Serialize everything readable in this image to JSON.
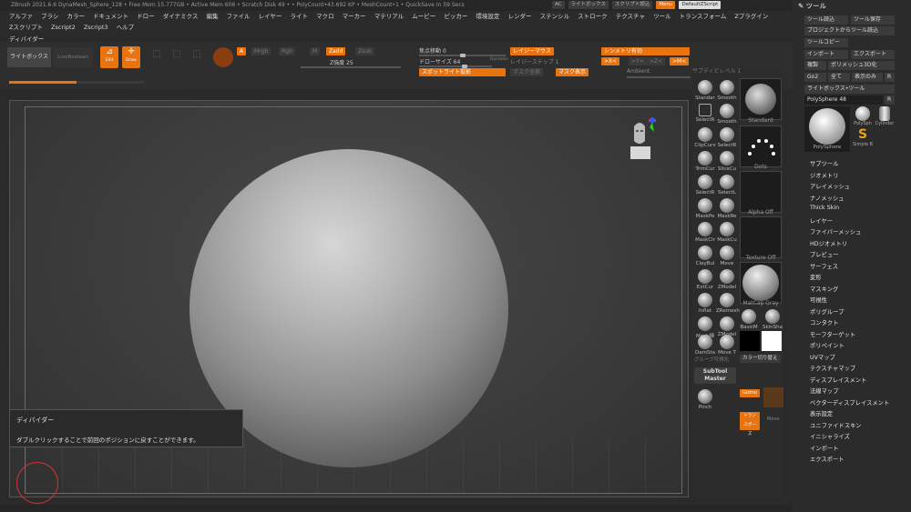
{
  "titlebar": {
    "text": "ZBrush 2021.6.6 DynaMesh_Sphere_128   • Free Mem 15.777GB • Active Mem 606 • Scratch Disk 49 •   • PolyCount•43.692 KP  • MeshCount•1  • QuickSave In 59 Secs",
    "buttons": [
      "AC",
      "ライトボックス",
      "スクリプト読込",
      "Menu",
      "DefaultZScript"
    ]
  },
  "menu": {
    "row1": [
      "アルファ",
      "ブラシ",
      "カラー",
      "ドキュメント",
      "ドロー",
      "ダイナミクス",
      "編集",
      "ファイル",
      "レイヤー",
      "ライト",
      "マクロ",
      "マーカー",
      "マテリアル",
      "ムービー",
      "ピッカー",
      "環境設定",
      "レンダー",
      "ステンシル",
      "ストローク",
      "テクスチャ",
      "ツール",
      "トランスフォーム",
      "Zプラグイン"
    ],
    "row2": [
      "Zスクリプト",
      "Zscript2",
      "Zscript3",
      "ヘルプ"
    ]
  },
  "divider_label": "ディバイダー",
  "shelf": {
    "lightbox": "ライトボックス",
    "live_boolean": "LiveBoolean",
    "edit": "Edit",
    "draw": "Draw",
    "move": "Move",
    "scale": "Scale",
    "rotate": "Rotate",
    "a_btn": "A",
    "mrgb": "Mrgb",
    "rgb": "Rgb",
    "m": "M",
    "zadd": "Zadd",
    "zsub": "Zsub",
    "z_intensity_label": "Z強度",
    "z_intensity_value": "25",
    "focal_label": "焦点移動",
    "focal_value": "0",
    "draw_size_label": "ドローサイズ",
    "draw_size_value": "64",
    "dynamic": "Dynamic",
    "lazymouse": "レイジーマウス",
    "lazystep_label": "レイジーステップ",
    "lazystep_value": "1",
    "symmetry": "シンメトリ有効",
    "x": ">X<",
    "y": ">Y<",
    "z": ">Z<",
    "m_sym": ">M<",
    "spotlight": "スポットライト投影",
    "mask_all": "マスク全部",
    "mask_show": "マスク表示",
    "ambient": "Ambient",
    "progress": 0.5
  },
  "tooltip": {
    "title": "ディバイダー",
    "body": "ダブルクリックすることで前回のポジションに戻すことができます。"
  },
  "midpalette": {
    "subdiv_label": "サブディビレベル",
    "subdiv_value": "1",
    "brushes": [
      [
        "Standar",
        "Smooth"
      ],
      [
        "SelectR",
        "Smooth"
      ],
      [
        "ClipCurv",
        "SelectR"
      ],
      [
        "TrimCur",
        "SliceCu"
      ],
      [
        "SelectR",
        "SelectL"
      ],
      [
        "MaskPe",
        "MaskRe"
      ],
      [
        "MaskCir",
        "MaskCu"
      ],
      [
        "ClayBui",
        "Move"
      ],
      [
        "ExtCur",
        "ZModel"
      ],
      [
        "Inflat",
        "ZRemesh"
      ],
      [
        "Mesh挿",
        "ZModel"
      ],
      [
        "DamSta",
        "Move T"
      ]
    ],
    "swatches": [
      "Standard",
      "Dots",
      "Alpha Off",
      "Texture Off",
      "MatCap Gray"
    ],
    "basicm": "BasicM",
    "skinshade": "SkinSha",
    "group_viz": "グループ可視化",
    "color_toggle": "カラー切り替え",
    "subtool_master": "SubTool Master",
    "pinch": "Pinch",
    "gizmo": "Gizmo",
    "transpose": "トランスポーズ",
    "move_label": "Move"
  },
  "rightpanel": {
    "title": "ツール",
    "buttons": [
      "ツール読込",
      "ツール保存",
      "プロジェクトからツール読込",
      "ツールコピー",
      "インポート",
      "エクスポート",
      "複製",
      "ポリメッシュ3D化",
      "Go2",
      "全て",
      "表示のみ",
      "R",
      "ライトボックス•ツール",
      "PolySphere",
      "48",
      "R"
    ],
    "thumbs": [
      "PolySphere",
      "PolySph",
      "Cylinder",
      "Simple B"
    ],
    "items": [
      "サブツール",
      "ジオメトリ",
      "アレイメッシュ",
      "ナノメッシュ",
      "Thick Skin",
      "レイヤー",
      "ファイバーメッシュ",
      "HDジオメトリ",
      "プレビュー",
      "サーフェス",
      "変形",
      "マスキング",
      "可視性",
      "ポリグループ",
      "コンタクト",
      "モーフターゲット",
      "ポリペイント",
      "UVマップ",
      "テクスチャマップ",
      "ディスプレイスメント",
      "法線マップ",
      "ベクターディスプレイスメント",
      "表示設定",
      "ユニファイドスキン",
      "イニシャライズ",
      "インポート",
      "エクスポート"
    ]
  }
}
